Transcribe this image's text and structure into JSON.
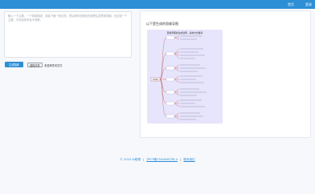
{
  "header": {
    "nav": [
      "首页",
      "登录"
    ]
  },
  "input": {
    "placeholder": "输入一个主题，一个简单描述，或者下面一篇文档，然后带你去换回去梳理生成思维导图，比如说一个主题，不对如何学会不熟悉。"
  },
  "actions": {
    "generate_label": "生成图库",
    "file_button_label": "选择文件",
    "file_status": "未选择任何文件"
  },
  "result": {
    "title": "以下是生成的思维导图",
    "mindmap_title": "思维导图的生成说明 - 多种方式推荐",
    "mindmap_root": "思维导图"
  },
  "footer": {
    "copyright": "© 2024 AI助理",
    "icp": "沪ICP备15006452号-4",
    "separator": "|",
    "contact": "联系我们"
  }
}
